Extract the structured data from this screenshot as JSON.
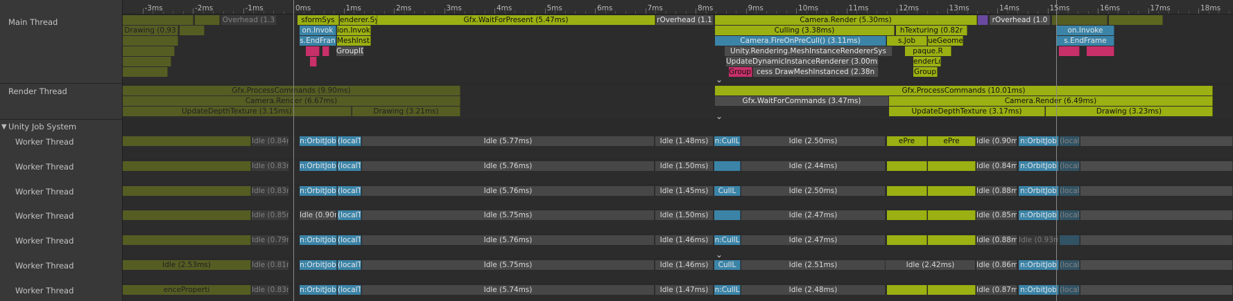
{
  "ruler": {
    "ticks": [
      "-3ms",
      "-2ms",
      "-1ms",
      "0ms",
      "1ms",
      "2ms",
      "3ms",
      "4ms",
      "5ms",
      "6ms",
      "7ms",
      "8ms",
      "9ms",
      "10ms",
      "11ms",
      "12ms",
      "13ms",
      "14ms",
      "15ms",
      "16ms",
      "17ms",
      "18ms"
    ]
  },
  "tracks": {
    "main_thread": "Main Thread",
    "render_thread": "Render Thread",
    "job_group": "Unity Job System",
    "worker": "Worker Thread"
  },
  "main": {
    "row1": {
      "overhead_left": "Overhead (1.3",
      "transform": "sformSys",
      "render_sys": "enderer.Sys",
      "wait_present": "Gfx.WaitForPresent (5.47ms)",
      "overhead_mid": "rOverhead (1.1",
      "camera_render": "Camera.Render (5.30ms)",
      "overhead_right": "rOverhead (1.0"
    },
    "row2": {
      "drawing_left": "Drawing (0.93",
      "on_invoke": "on.Invok",
      "ion_invoke": "ion.Invoke",
      "culling": "Culling (3.38ms)",
      "texturing": "hTexturing (0.82r",
      "on_invoke_r": "on.Invoke"
    },
    "row3": {
      "end_frame": "s.EndFran",
      "mesh_insta": "MeshInsta",
      "fire_on_pre_cull": "Camera.FireOnPreCull() (3.11ms)",
      "job_geom": "s.Job",
      "ue_geome": "ueGeome",
      "end_frame_r": "s.EndFrame"
    },
    "row4": {
      "group_id": "GroupID",
      "mesh_instance_sys": "Unity.Rendering.MeshInstanceRendererSys",
      "opaque": "paque.R"
    },
    "row5": {
      "update_dynamic": "UpdateDynamicInstanceRenderer (3.00ms)",
      "render_lo": "enderLo"
    },
    "row6": {
      "group_draw": "GroupID",
      "draw_mesh_instanced": "cess DrawMeshInstanced (2.38n",
      "group_r": "Group"
    }
  },
  "render": {
    "process_commands_left": "Gfx.ProcessCommands (9.90ms)",
    "camera_render_left": "Camera.Render (6.67ms)",
    "update_depth_left": "UpdateDepthTexture (3.15ms)",
    "drawing_left": "Drawing (3.21ms)",
    "process_commands": "Gfx.ProcessCommands (10.01ms)",
    "wait_commands": "Gfx.WaitForCommands (3.47ms)",
    "camera_render": "Camera.Render (6.49ms)",
    "update_depth": "UpdateDepthTexture (3.17ms)",
    "drawing": "Drawing (3.23ms)"
  },
  "workers": [
    {
      "pre": "Idle (0.84ms)",
      "orbit": "n:OrbitJob",
      "local": "(localT",
      "idle1": "Idle (5.77ms)",
      "idle2": "Idle (1.48ms)",
      "cull": "n:CullL",
      "idle3": "Idle (2.50ms)",
      "mid": "ePre",
      "mid2": "ePre",
      "idle4": "Idle (0.90ms)",
      "orbit_r": "n:OrbitJob",
      "local_r": "(localT"
    },
    {
      "pre": "Idle (0.83ms)",
      "orbit": "n:OrbitJob",
      "local": "(localT",
      "idle1": "Idle (5.76ms)",
      "idle2": "Idle (1.50ms)",
      "cull": "",
      "idle3": "Idle (2.44ms)",
      "mid": "",
      "mid2": "",
      "idle4": "Idle (0.84ms)",
      "orbit_r": "n:OrbitJob",
      "local_r": "(localT"
    },
    {
      "pre": "Idle (0.83ms)",
      "orbit": "n:OrbitJob",
      "local": "(localT",
      "idle1": "Idle (5.76ms)",
      "idle2": "Idle (1.45ms)",
      "cull": "CullL",
      "idle3": "Idle (2.50ms)",
      "mid": "",
      "mid2": "",
      "idle4": "Idle (0.88ms)",
      "orbit_r": "n:OrbitJob",
      "local_r": "(localT"
    },
    {
      "pre": "Idle (0.85ms)",
      "orbit": "Idle (0.90ms)",
      "local": "(localT",
      "idle1": "Idle (5.75ms)",
      "idle2": "Idle (1.50ms)",
      "cull": "",
      "idle3": "Idle (2.47ms)",
      "mid": "",
      "mid2": "",
      "idle4": "Idle (0.85ms)",
      "orbit_r": "n:OrbitJob",
      "local_r": "(localT"
    },
    {
      "pre": "Idle (0.79ms)",
      "orbit": "n:OrbitJob",
      "local": "(localT",
      "idle1": "Idle (5.76ms)",
      "idle2": "Idle (1.46ms)",
      "cull": "n:CullL",
      "idle3": "Idle (2.47ms)",
      "mid": "",
      "mid2": "",
      "idle4": "Idle (0.88ms)",
      "orbit_r": "Idle (0.93ms)",
      "local_r": ""
    },
    {
      "pre": "Idle (0.81ms)",
      "orbit": "n:OrbitJob",
      "local": "(localT",
      "idle1": "Idle (5.75ms)",
      "idle2": "Idle (1.46ms)",
      "cull": "CullL",
      "idle3": "Idle (2.51ms)",
      "mid": "Idle (2.42ms)",
      "mid2": "",
      "idle4": "Idle (0.86ms)",
      "orbit_r": "n:OrbitJob",
      "local_r": "(localT"
    },
    {
      "pre": "Idle (0.83ms)",
      "orbit": "n:OrbitJob",
      "local": "(localT",
      "idle1": "Idle (5.74ms)",
      "idle2": "Idle (1.47ms)",
      "cull": "n:CullL",
      "idle3": "Idle (2.48ms)",
      "mid": "",
      "mid2": "",
      "idle4": "Idle (0.87ms)",
      "orbit_r": "n:OrbitJob",
      "local_r": "(localT"
    }
  ],
  "worker_extra_left": [
    "",
    "",
    "",
    "",
    "",
    "Idle (2.53ms)",
    "enceProperti"
  ],
  "colors": {
    "background": "#282828",
    "label_panel": "#383838",
    "job_green": "#9bb012",
    "job_olive": "#8a9a1a",
    "job_blue": "#3b84a8",
    "job_pink": "#c8306a",
    "idle_grey": "#474747"
  },
  "icons": {
    "expand": "chevron-down-icon",
    "group_toggle": "triangle-down-icon"
  }
}
